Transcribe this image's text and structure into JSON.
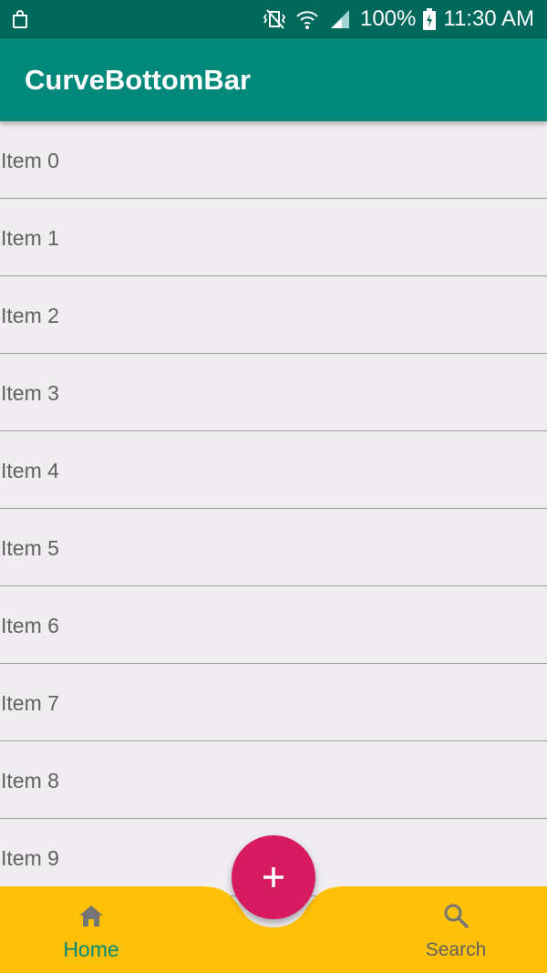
{
  "status_bar": {
    "battery_percent": "100%",
    "time": "11:30 AM",
    "icons": [
      "bag-icon",
      "vibrate-icon",
      "wifi-icon",
      "signal-icon",
      "battery-icon"
    ]
  },
  "app_bar": {
    "title": "CurveBottomBar",
    "color": "#00897b"
  },
  "list": {
    "items": [
      {
        "label": "Item 0"
      },
      {
        "label": "Item 1"
      },
      {
        "label": "Item 2"
      },
      {
        "label": "Item 3"
      },
      {
        "label": "Item 4"
      },
      {
        "label": "Item 5"
      },
      {
        "label": "Item 6"
      },
      {
        "label": "Item 7"
      },
      {
        "label": "Item 8"
      },
      {
        "label": "Item 9"
      }
    ]
  },
  "bottom_nav": {
    "background_color": "#ffc107",
    "home": {
      "label": "Home",
      "icon": "home-icon",
      "active_color": "#00897b"
    },
    "search": {
      "label": "Search",
      "icon": "search-icon"
    }
  },
  "fab": {
    "icon": "plus-icon",
    "color": "#d81b60"
  }
}
